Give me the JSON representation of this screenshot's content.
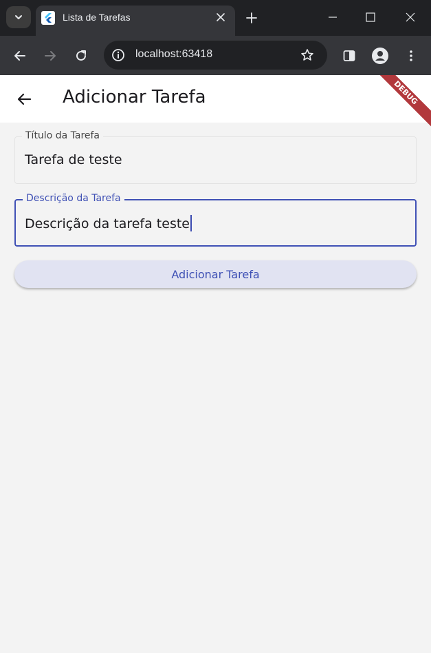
{
  "browser": {
    "tab_title": "Lista de Tarefas",
    "url": "localhost:63418",
    "accent": "#202124"
  },
  "appbar": {
    "title": "Adicionar Tarefa",
    "debug_banner": "DEBUG"
  },
  "form": {
    "title_field": {
      "label": "Título da Tarefa",
      "value": "Tarefa de teste"
    },
    "description_field": {
      "label": "Descrição da Tarefa",
      "value": "Descrição da tarefa teste",
      "focused": true
    },
    "submit_label": "Adicionar Tarefa"
  },
  "colors": {
    "primary": "#3f51b5",
    "button_bg": "#e1e3f2",
    "page_bg": "#f3f3f3",
    "debug_banner": "#b2383c"
  },
  "icons": {
    "tab_search": "chevron-down-icon",
    "favicon": "flutter-icon",
    "tab_close": "close-icon",
    "new_tab": "plus-icon",
    "minimize": "minimize-icon",
    "maximize": "maximize-icon",
    "close_window": "close-icon",
    "back": "arrow-left-icon",
    "forward": "arrow-right-icon",
    "reload": "reload-icon",
    "site_info": "info-icon",
    "bookmark": "star-icon",
    "side_panel": "side-panel-icon",
    "profile": "profile-icon",
    "menu": "kebab-menu-icon",
    "appbar_back": "arrow-left-icon"
  }
}
